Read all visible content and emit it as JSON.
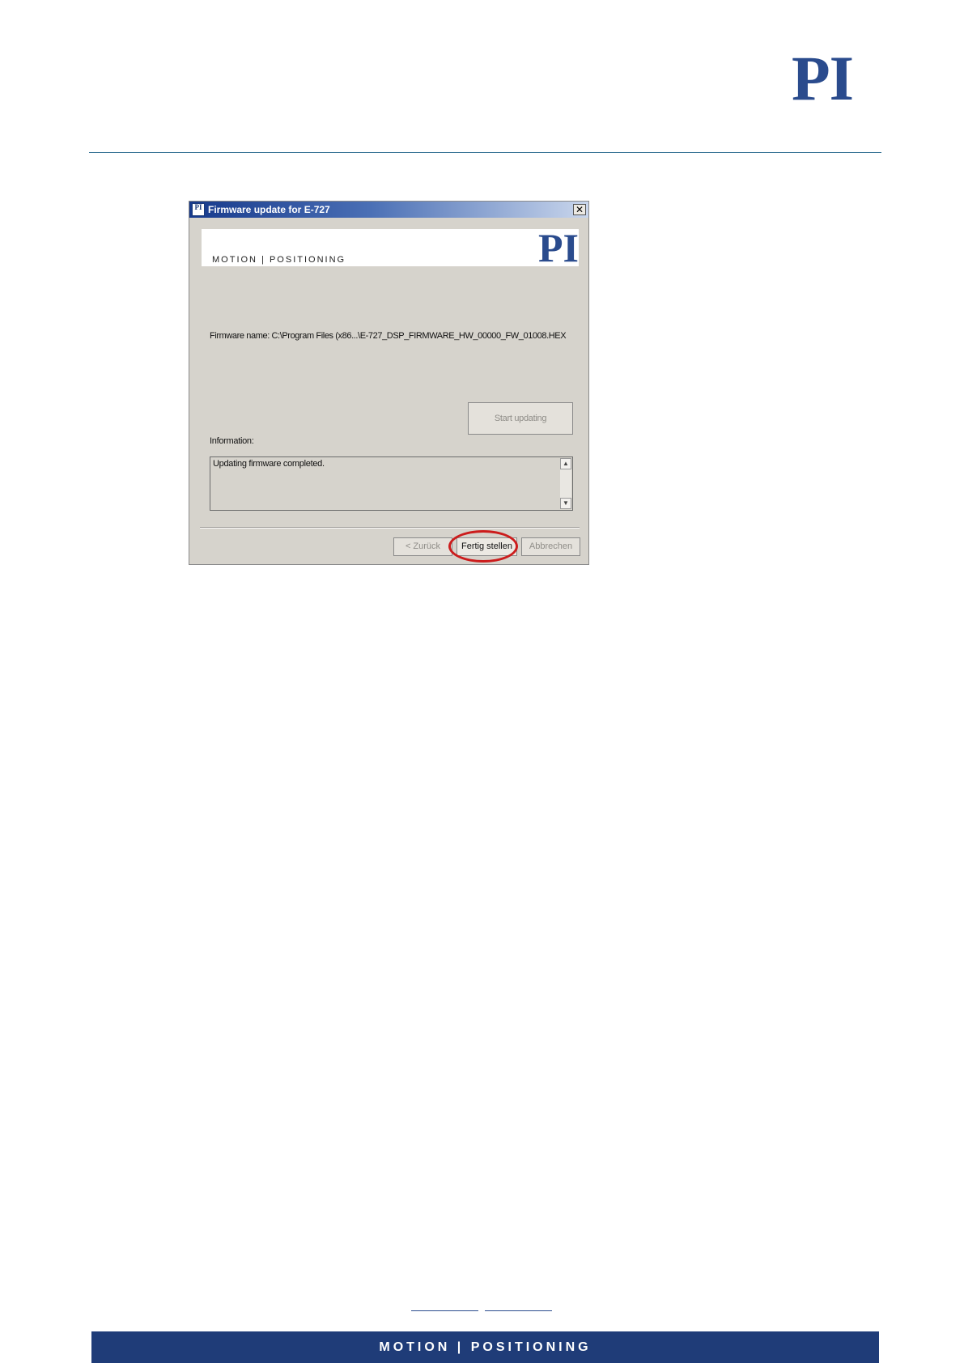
{
  "page": {
    "logo": "PI",
    "footer_tagline": "MOTION | POSITIONING"
  },
  "dialog": {
    "title": "Firmware update for E-727",
    "title_icon": "PI",
    "close_glyph": "✕",
    "banner": {
      "tagline": "MOTION  |  POSITIONING",
      "logo": "PI"
    },
    "firmware_name": "Firmware name: C:\\Program Files (x86...\\E-727_DSP_FIRMWARE_HW_00000_FW_01008.HEX",
    "start_button": "Start updating",
    "information_label": "Information:",
    "information_text": "Updating firmware completed.",
    "scroll_up": "▲",
    "scroll_down": "▼",
    "buttons": {
      "back": "< Zurück",
      "finish": "Fertig stellen",
      "cancel": "Abbrechen"
    },
    "highlight_color": "#cc1c1c"
  },
  "colors": {
    "brand_blue": "#2a4b8d",
    "footer_bar": "#1f3c78",
    "dialog_bg": "#d6d3cc"
  }
}
